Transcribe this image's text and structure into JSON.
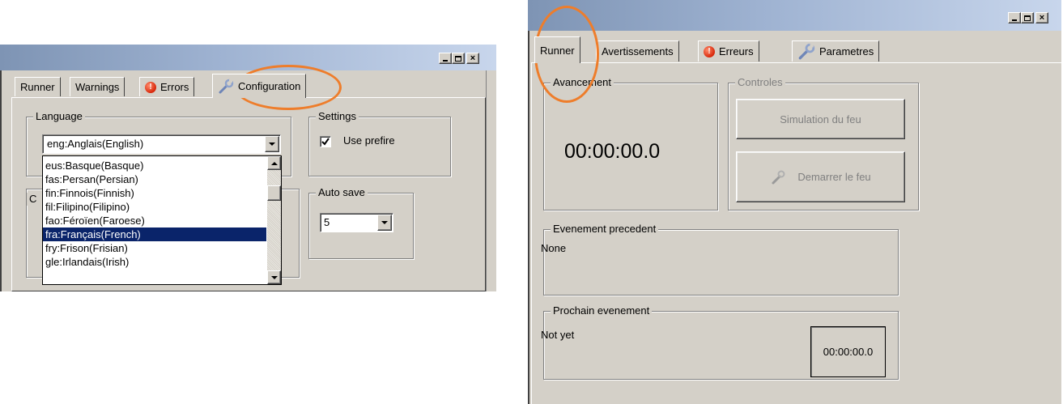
{
  "left_window": {
    "tabs": [
      "Runner",
      "Warnings",
      "Errors",
      "Configuration"
    ],
    "language": {
      "legend": "Language",
      "selected": "eng:Anglais(English)",
      "options": [
        "eus:Basque(Basque)",
        "fas:Persan(Persian)",
        "fin:Finnois(Finnish)",
        "fil:Filipino(Filipino)",
        "fao:Féroïen(Faroese)",
        "fra:Français(French)",
        "fry:Frison(Frisian)",
        "gle:Irlandais(Irish)"
      ],
      "highlighted_option": "fra:Français(French)"
    },
    "settings": {
      "legend": "Settings",
      "checkbox_label": "Use prefire",
      "checked": true
    },
    "auto_save": {
      "legend": "Auto save",
      "value": "5"
    },
    "hidden_group_fragment": "C"
  },
  "right_window": {
    "tabs": [
      "Runner",
      "Avertissements",
      "Erreurs",
      "Parametres"
    ],
    "progress": {
      "legend": "Avancement",
      "timer": "00:00:00.0"
    },
    "controls": {
      "legend": "Controles",
      "simulation_button": "Simulation du feu",
      "start_button": "Demarrer le feu"
    },
    "previous_event": {
      "legend": "Evenement precedent",
      "value": "None"
    },
    "next_event": {
      "legend": "Prochain evenement",
      "value": "Not yet",
      "timer": "00:00:00.0"
    }
  },
  "window_controls": {
    "minimize": "_",
    "maximize": "□",
    "close": "×"
  },
  "colors": {
    "titlebar_gradient": [
      "#7e94b4",
      "#c8d6ec"
    ],
    "face": "#d4d0c8",
    "selection": "#0a246a",
    "annotation": "#ee7d2b"
  },
  "icons": [
    "error-icon",
    "wrench-icon",
    "checkbox-check-icon",
    "dropdown-arrow-icon",
    "scroll-up-icon",
    "scroll-down-icon"
  ]
}
